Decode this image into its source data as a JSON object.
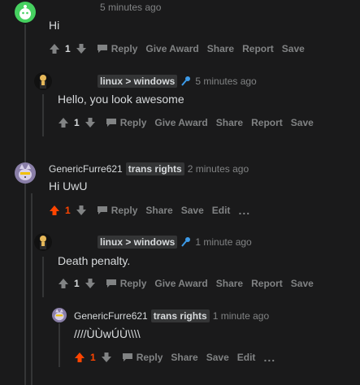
{
  "comments": [
    {
      "id": "c1",
      "author": "",
      "flair": "",
      "time": "5 minutes ago",
      "body": "Hi",
      "score": "1",
      "upvoted": false,
      "actions": [
        "Reply",
        "Give Award",
        "Share",
        "Report",
        "Save"
      ]
    },
    {
      "id": "c2",
      "author": "",
      "flair": "linux > windows",
      "flair_emoji": "microphone-icon",
      "time": "5 minutes ago",
      "body": "Hello, you look awesome",
      "score": "1",
      "upvoted": false,
      "actions": [
        "Reply",
        "Give Award",
        "Share",
        "Report",
        "Save"
      ]
    },
    {
      "id": "c3",
      "author": "GenericFurre621",
      "flair": "trans rights",
      "time": "2 minutes ago",
      "body": "Hi UwU",
      "score": "1",
      "upvoted": true,
      "actions": [
        "Reply",
        "Share",
        "Save",
        "Edit",
        "..."
      ]
    },
    {
      "id": "c4",
      "author": "",
      "flair": "linux > windows",
      "flair_emoji": "microphone-icon",
      "time": "1 minute ago",
      "body": "Death penalty.",
      "score": "1",
      "upvoted": false,
      "actions": [
        "Reply",
        "Give Award",
        "Share",
        "Report",
        "Save"
      ]
    },
    {
      "id": "c5",
      "author": "GenericFurre621",
      "flair": "trans rights",
      "time": "1 minute ago",
      "body": "////ÙÙwÚÙ\\\\\\\\",
      "score": "1",
      "upvoted": true,
      "actions": [
        "Reply",
        "Share",
        "Save",
        "Edit",
        "..."
      ]
    }
  ],
  "colors": {
    "upvote": "#ff4500",
    "muted": "#818384",
    "text": "#d7dadc",
    "bg": "#1a1a1b"
  }
}
